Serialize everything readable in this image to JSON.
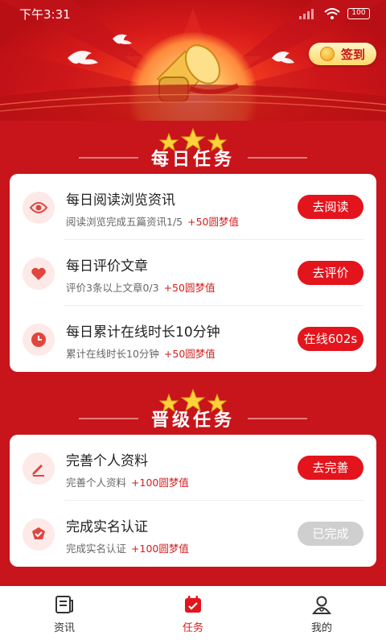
{
  "status_bar": {
    "time": "下午3:31",
    "battery": "100"
  },
  "header": {
    "signin_label": "签到"
  },
  "daily": {
    "title": "每日任务",
    "tasks": [
      {
        "title": "每日阅读浏览资讯",
        "desc": "阅读浏览完成五篇资讯1/5",
        "reward": "+50圆梦值",
        "button": "去阅读",
        "icon": "eye-icon",
        "done": false
      },
      {
        "title": "每日评价文章",
        "desc": "评价3条以上文章0/3",
        "reward": "+50圆梦值",
        "button": "去评价",
        "icon": "heart-icon",
        "done": false
      },
      {
        "title": "每日累计在线时长10分钟",
        "desc": "累计在线时长10分钟",
        "reward": "+50圆梦值",
        "button": "在线602s",
        "icon": "clock-icon",
        "done": false
      }
    ]
  },
  "upgrade": {
    "title": "晋级任务",
    "tasks": [
      {
        "title": "完善个人资料",
        "desc": "完善个人资料",
        "reward": "+100圆梦值",
        "button": "去完善",
        "icon": "edit-icon",
        "done": false
      },
      {
        "title": "完成实名认证",
        "desc": "完成实名认证",
        "reward": "+100圆梦值",
        "button": "已完成",
        "icon": "verify-icon",
        "done": true
      }
    ]
  },
  "bottom_nav": {
    "items": [
      {
        "label": "资讯",
        "icon": "news-icon",
        "active": false
      },
      {
        "label": "任务",
        "icon": "calendar-icon",
        "active": true
      },
      {
        "label": "我的",
        "icon": "user-icon",
        "active": false
      }
    ]
  },
  "colors": {
    "primary_red": "#c8141b",
    "button_red": "#e3141c",
    "reward_red": "#d0201e",
    "done_gray": "#cfcfcf"
  }
}
